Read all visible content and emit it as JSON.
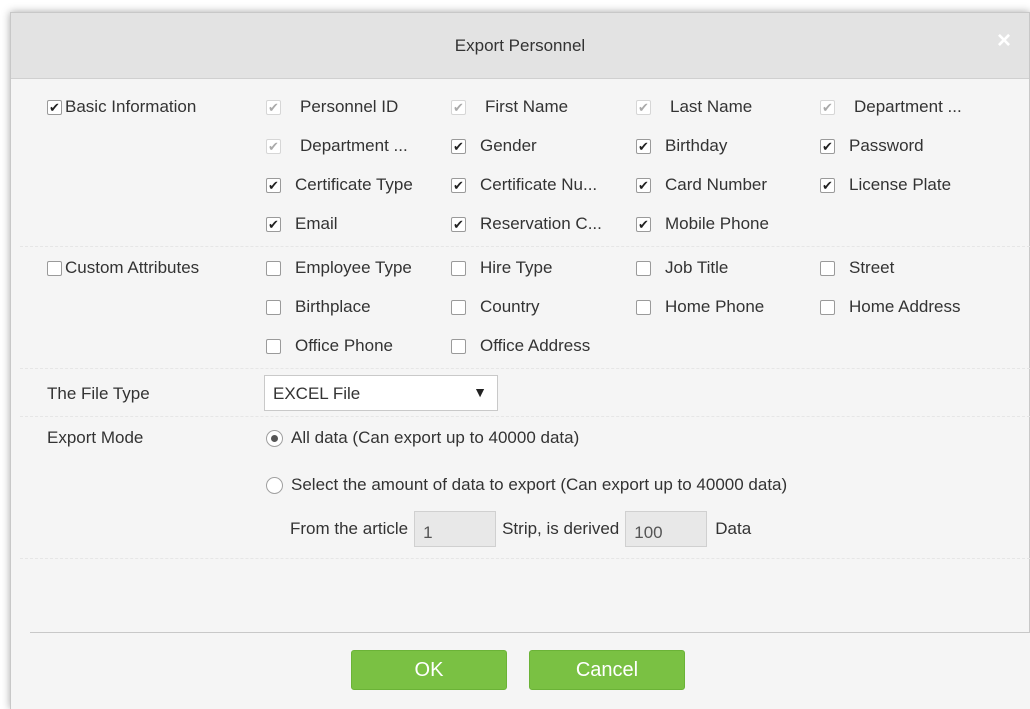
{
  "dialog": {
    "title": "Export Personnel",
    "close_glyph": "×"
  },
  "basic": {
    "label": "Basic Information",
    "checked": true,
    "fields": [
      {
        "label": "Personnel ID",
        "state": "disabled"
      },
      {
        "label": "First Name",
        "state": "disabled"
      },
      {
        "label": "Last Name",
        "state": "disabled"
      },
      {
        "label": "Department ...",
        "state": "disabled"
      },
      {
        "label": "Department ...",
        "state": "disabled"
      },
      {
        "label": "Gender",
        "state": "checked"
      },
      {
        "label": "Birthday",
        "state": "checked"
      },
      {
        "label": "Password",
        "state": "checked"
      },
      {
        "label": "Certificate Type",
        "state": "checked"
      },
      {
        "label": "Certificate Nu...",
        "state": "checked"
      },
      {
        "label": "Card Number",
        "state": "checked"
      },
      {
        "label": "License Plate",
        "state": "checked"
      },
      {
        "label": "Email",
        "state": "checked"
      },
      {
        "label": "Reservation C...",
        "state": "checked"
      },
      {
        "label": "Mobile Phone",
        "state": "checked"
      }
    ]
  },
  "custom": {
    "label": "Custom Attributes",
    "checked": false,
    "fields": [
      {
        "label": "Employee Type",
        "state": "unchecked"
      },
      {
        "label": "Hire Type",
        "state": "unchecked"
      },
      {
        "label": "Job Title",
        "state": "unchecked"
      },
      {
        "label": "Street",
        "state": "unchecked"
      },
      {
        "label": "Birthplace",
        "state": "unchecked"
      },
      {
        "label": "Country",
        "state": "unchecked"
      },
      {
        "label": "Home Phone",
        "state": "unchecked"
      },
      {
        "label": "Home Address",
        "state": "unchecked"
      },
      {
        "label": "Office Phone",
        "state": "unchecked"
      },
      {
        "label": "Office Address",
        "state": "unchecked"
      }
    ]
  },
  "file_type": {
    "label": "The File Type",
    "selected": "EXCEL File",
    "arrow": "▼"
  },
  "export_mode": {
    "label": "Export Mode",
    "option_all": "All data (Can export up to 40000 data)",
    "option_amount": "Select the amount of data to export (Can export up to 40000 data)",
    "selected": "all",
    "from_label": "From the article",
    "from_value": "1",
    "strip_label": "Strip, is derived",
    "to_value": "100",
    "data_label": "Data"
  },
  "buttons": {
    "ok": "OK",
    "cancel": "Cancel"
  },
  "colors": {
    "button_green": "#7ac143",
    "titlebar": "#e3e3e3"
  }
}
